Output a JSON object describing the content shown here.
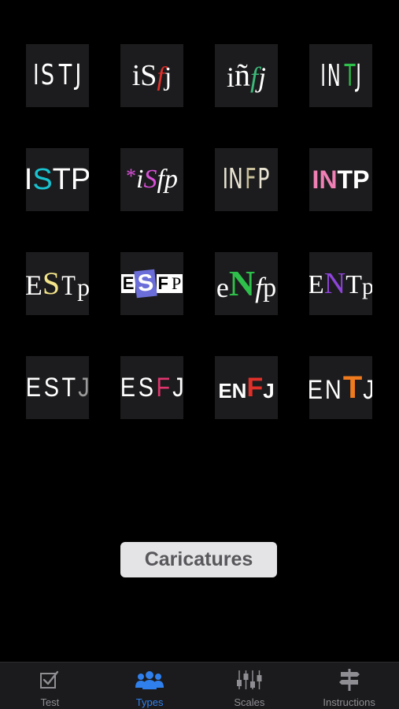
{
  "types": [
    {
      "id": "istj",
      "letters": [
        "I",
        "S",
        "T",
        "J"
      ]
    },
    {
      "id": "isfj",
      "letters": [
        "i",
        "S",
        "f",
        "j"
      ]
    },
    {
      "id": "infj",
      "letters": [
        "i",
        "ñ",
        "f",
        "j"
      ]
    },
    {
      "id": "intj",
      "letters": [
        "I",
        "N",
        "T",
        "J"
      ]
    },
    {
      "id": "istp",
      "letters": [
        "I",
        "S",
        "T",
        "P"
      ]
    },
    {
      "id": "isfp",
      "letters": [
        "*",
        "i",
        "S",
        "f",
        "p"
      ]
    },
    {
      "id": "infp",
      "letters": [
        "I",
        "N",
        "F",
        "P"
      ]
    },
    {
      "id": "intp",
      "letters": [
        "I",
        "N",
        "T",
        "P"
      ]
    },
    {
      "id": "estp",
      "letters": [
        "E",
        "S",
        "T",
        "p"
      ]
    },
    {
      "id": "esfp",
      "letters": [
        "E",
        "S",
        "F",
        "P"
      ]
    },
    {
      "id": "enfp",
      "letters": [
        "e",
        "N",
        "f",
        "p"
      ]
    },
    {
      "id": "entp",
      "letters": [
        "E",
        "N",
        "T",
        "p"
      ]
    },
    {
      "id": "estj",
      "letters": [
        "E",
        "S",
        "T",
        "J"
      ]
    },
    {
      "id": "esfj",
      "letters": [
        "E",
        "S",
        "F",
        "J"
      ]
    },
    {
      "id": "enfj",
      "letters": [
        "E",
        "N",
        "F",
        "J"
      ]
    },
    {
      "id": "entj",
      "letters": [
        "E",
        "N",
        "T",
        "J"
      ]
    }
  ],
  "main_button": {
    "label": "Caricatures"
  },
  "tabbar": {
    "tabs": [
      {
        "label": "Test",
        "icon": "checkbox-icon"
      },
      {
        "label": "Types",
        "icon": "people-icon"
      },
      {
        "label": "Scales",
        "icon": "sliders-icon"
      },
      {
        "label": "Instructions",
        "icon": "signpost-icon"
      }
    ],
    "active_tab": "Types"
  },
  "colors": {
    "background": "#000000",
    "tile": "#1c1c1e",
    "tab_active": "#2f80ed",
    "tab_inactive": "#8e8e93",
    "button_bg": "#e4e4e6",
    "button_text": "#58585c"
  }
}
